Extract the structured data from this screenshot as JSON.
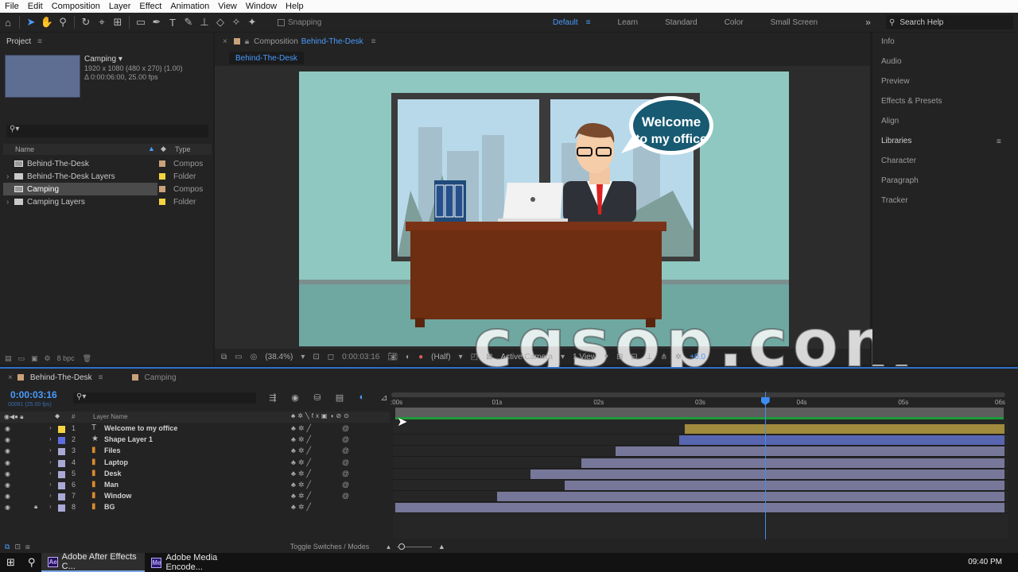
{
  "menu": [
    "File",
    "Edit",
    "Composition",
    "Layer",
    "Effect",
    "Animation",
    "View",
    "Window",
    "Help"
  ],
  "toolbar": {
    "snapping_label": "Snapping",
    "workspaces": [
      {
        "label": "Default",
        "active": true
      },
      {
        "label": "Learn",
        "active": false
      },
      {
        "label": "Standard",
        "active": false
      },
      {
        "label": "Color",
        "active": false
      },
      {
        "label": "Small Screen",
        "active": false
      }
    ],
    "search_placeholder": "Search Help"
  },
  "project": {
    "tab_label": "Project",
    "selected_name": "Camping",
    "selected_meta": [
      "1920 x 1080  (480 x 270) (1.00)",
      "Δ 0:00:06:00, 25.00 fps"
    ],
    "search_placeholder": "",
    "columns": {
      "name": "Name",
      "type": "Type"
    },
    "items": [
      {
        "name": "Behind-The-Desk",
        "type": "Compos",
        "icon": "comp-icon",
        "color": "#c9a27a",
        "selected": false
      },
      {
        "name": "Behind-The-Desk Layers",
        "type": "Folder",
        "icon": "folder-icon",
        "color": "#f5d442",
        "selected": false
      },
      {
        "name": "Camping",
        "type": "Compos",
        "icon": "comp-icon",
        "color": "#c9a27a",
        "selected": true
      },
      {
        "name": "Camping Layers",
        "type": "Folder",
        "icon": "folder-icon",
        "color": "#f5d442",
        "selected": false
      }
    ],
    "bpc": "8 bpc"
  },
  "composition": {
    "tab_prefix": "Composition",
    "tab_name": "Behind-The-Desk",
    "sub_tab": "Behind-The-Desk",
    "speech_bubble": [
      "Welcome",
      "to my office"
    ],
    "watermark": "cgsop.com",
    "controls": {
      "zoom": "(38.4%)",
      "timecode": "0:00:03:16",
      "resolution": "(Half)",
      "camera": "Active Camera",
      "views": "1 View",
      "exposure": "+0.0"
    }
  },
  "right_panel": {
    "items": [
      {
        "label": "Info",
        "bold": false
      },
      {
        "label": "Audio",
        "bold": false
      },
      {
        "label": "Preview",
        "bold": false
      },
      {
        "label": "Effects & Presets",
        "bold": false
      },
      {
        "label": "Align",
        "bold": false
      },
      {
        "label": "Libraries",
        "bold": true
      },
      {
        "label": "Character",
        "bold": false
      },
      {
        "label": "Paragraph",
        "bold": false
      },
      {
        "label": "Tracker",
        "bold": false
      }
    ]
  },
  "timeline": {
    "tabs": [
      {
        "label": "Behind-The-Desk",
        "active": true,
        "color": "#c9a27a"
      },
      {
        "label": "Camping",
        "active": false,
        "color": "#c9a27a"
      }
    ],
    "current_time": "0:00:03:16",
    "frames": "00091 (25.00 fps)",
    "search_placeholder": "",
    "layer_header": {
      "num": "#",
      "name": "Layer Name"
    },
    "ruler_ticks": [
      ":00s",
      "01s",
      "02s",
      "03s",
      "04s",
      "05s",
      "06s"
    ],
    "cti_seconds": 3.64,
    "duration_seconds": 6,
    "layers": [
      {
        "num": "1",
        "name": "Welcome to my office",
        "type": "text",
        "label_color": "#f5d442",
        "bar_color": "#a08a3e",
        "in_seconds": 2.85,
        "lock": false
      },
      {
        "num": "2",
        "name": "Shape Layer 1",
        "type": "shape",
        "label_color": "#5b6de0",
        "bar_color": "#5865b0",
        "in_seconds": 2.8,
        "lock": false
      },
      {
        "num": "3",
        "name": "Files",
        "type": "precomp",
        "label_color": "#a9a9d6",
        "bar_color": "#77779a",
        "in_seconds": 2.17,
        "lock": false
      },
      {
        "num": "4",
        "name": "Laptop",
        "type": "precomp",
        "label_color": "#a9a9d6",
        "bar_color": "#77779a",
        "in_seconds": 1.83,
        "lock": false
      },
      {
        "num": "5",
        "name": "Desk",
        "type": "precomp",
        "label_color": "#a9a9d6",
        "bar_color": "#77779a",
        "in_seconds": 1.33,
        "lock": false
      },
      {
        "num": "6",
        "name": "Man",
        "type": "precomp",
        "label_color": "#a9a9d6",
        "bar_color": "#77779a",
        "in_seconds": 1.67,
        "lock": false
      },
      {
        "num": "7",
        "name": "Window",
        "type": "precomp",
        "label_color": "#a9a9d6",
        "bar_color": "#77779a",
        "in_seconds": 1.0,
        "lock": false
      },
      {
        "num": "8",
        "name": "BG",
        "type": "precomp",
        "label_color": "#a9a9d6",
        "bar_color": "#77779a",
        "in_seconds": 0.0,
        "lock": true
      }
    ],
    "footer_label": "Toggle Switches / Modes"
  },
  "taskbar": {
    "apps": [
      {
        "label": "Adobe After Effects C...",
        "logo": "Ae",
        "active": true
      },
      {
        "label": "Adobe Media Encode...",
        "logo": "Me",
        "active": false
      }
    ],
    "clock": "09:40 PM"
  }
}
